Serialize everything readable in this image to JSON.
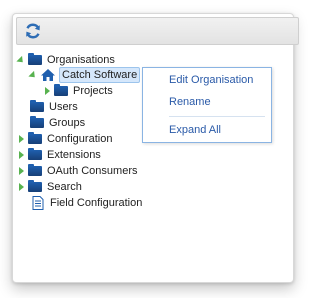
{
  "toolbar": {
    "refresh_icon": "refresh-icon"
  },
  "tree": {
    "items": [
      {
        "label": "Organisations",
        "icon": "folder-icon",
        "expander": "expanded"
      },
      {
        "label": "Catch Software",
        "icon": "home-icon",
        "expander": "expanded",
        "selected": true
      },
      {
        "label": "Projects",
        "icon": "folder-icon",
        "expander": "collapsed"
      },
      {
        "label": "Users",
        "icon": "folder-icon",
        "expander": "none"
      },
      {
        "label": "Groups",
        "icon": "folder-icon",
        "expander": "none"
      },
      {
        "label": "Configuration",
        "icon": "folder-icon",
        "expander": "collapsed"
      },
      {
        "label": "Extensions",
        "icon": "folder-icon",
        "expander": "collapsed"
      },
      {
        "label": "OAuth Consumers",
        "icon": "folder-icon",
        "expander": "collapsed"
      },
      {
        "label": "Search",
        "icon": "folder-icon",
        "expander": "collapsed"
      },
      {
        "label": "Field Configuration",
        "icon": "document-icon",
        "expander": "none"
      }
    ]
  },
  "context_menu": {
    "items": [
      "Edit Organisation",
      "Rename",
      "Expand All"
    ]
  },
  "colors": {
    "accent": "#2a5aa8",
    "expander_green": "#58b24f",
    "folder_blue": "#1f5fae"
  }
}
